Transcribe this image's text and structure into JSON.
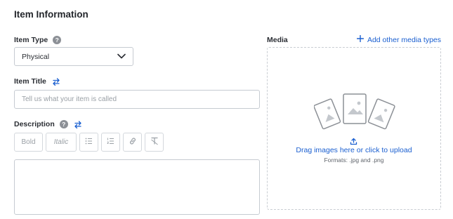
{
  "section": {
    "title": "Item Information"
  },
  "item_type": {
    "label": "Item Type",
    "help_icon": "help-icon",
    "help_glyph": "?",
    "value": "Physical",
    "chevron": "chevron-down-icon"
  },
  "item_title": {
    "label": "Item Title",
    "swap_icon": "swap-icon",
    "placeholder": "Tell us what your item is called"
  },
  "description": {
    "label": "Description",
    "help_glyph": "?",
    "toolbar": {
      "bold": "Bold",
      "italic": "Italic",
      "bullet_list_icon": "bullet-list-icon",
      "numbered_list_icon": "numbered-list-icon",
      "link_icon": "link-icon",
      "clear_format_icon": "clear-format-icon"
    }
  },
  "media": {
    "label": "Media",
    "add_types": "Add other media types",
    "drag_text": "Drag images here or click to upload",
    "formats": "Formats: .jpg and .png"
  },
  "colors": {
    "accent": "#1a5fd0",
    "border": "#c6cbd1",
    "text": "#23262b",
    "muted": "#9aa0a6"
  }
}
